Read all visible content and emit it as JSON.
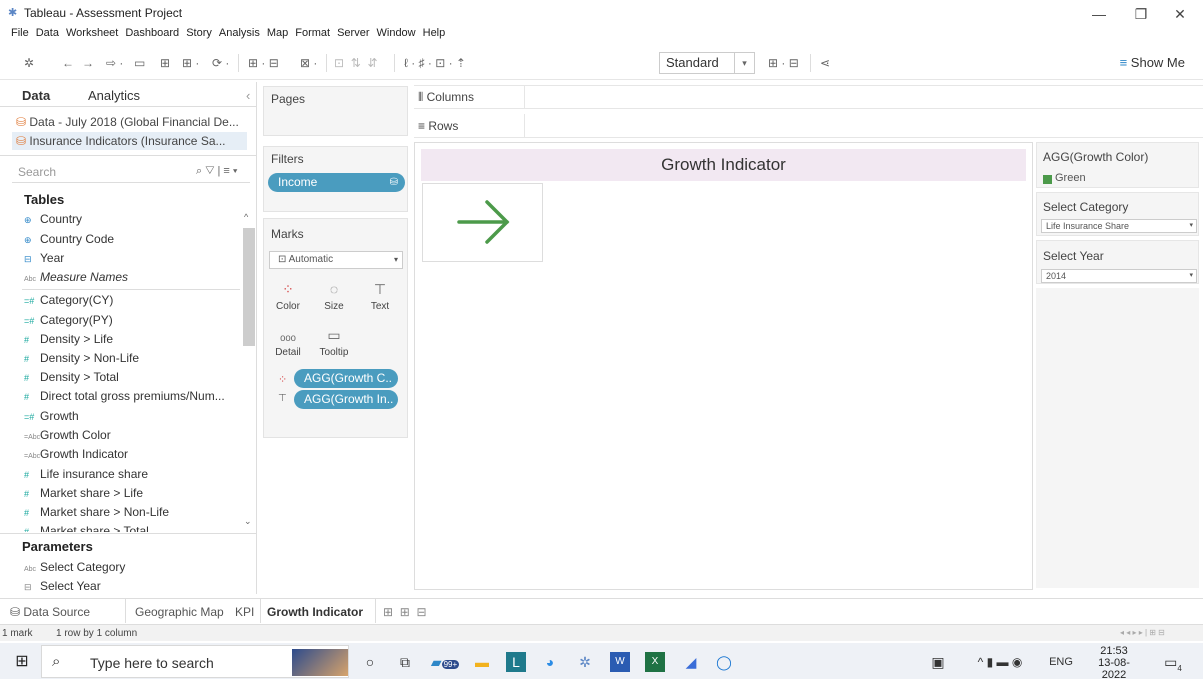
{
  "window": {
    "title": "Tableau - Assessment Project",
    "logo_icon": "tableau-logo-icon"
  },
  "menu": [
    "File",
    "Data",
    "Worksheet",
    "Dashboard",
    "Story",
    "Analysis",
    "Map",
    "Format",
    "Server",
    "Window",
    "Help"
  ],
  "toolbar": {
    "fit_select": "Standard",
    "show_me": "Show Me"
  },
  "data_pane": {
    "tabs": [
      "Data",
      "Analytics"
    ],
    "sources": [
      "Data - July 2018 (Global Financial De...",
      "Insurance Indicators (Insurance Sa..."
    ],
    "search_placeholder": "Search",
    "tables_heading": "Tables",
    "fields": [
      "Country",
      "Country Code",
      "Year",
      "Measure Names",
      "Category(CY)",
      "Category(PY)",
      "Density > Life",
      "Density > Non-Life",
      "Density > Total",
      "Direct total gross premiums/Num...",
      "Growth",
      "Growth Color",
      "Growth Indicator",
      "Life insurance share",
      "Market share > Life",
      "Market share > Non-Life",
      "Market share > Total"
    ],
    "parameters_heading": "Parameters",
    "parameters": [
      "Select Category",
      "Select Year"
    ]
  },
  "shelves": {
    "pages": "Pages",
    "filters": "Filters",
    "filter_pill": "Income",
    "marks": "Marks",
    "mark_type": "Automatic",
    "mark_buttons": [
      "Color",
      "Size",
      "Text",
      "Detail",
      "Tooltip"
    ],
    "mark_pills": [
      "AGG(Growth C..",
      "AGG(Growth In.."
    ],
    "columns": "Columns",
    "rows": "Rows"
  },
  "view": {
    "title": "Growth Indicator",
    "arrow_color": "#4c9a4a"
  },
  "right_pane": {
    "legend_title": "AGG(Growth Color)",
    "legend_item": "Green",
    "legend_color": "#4c9a4a",
    "param1_title": "Select Category",
    "param1_value": "Life Insurance Share",
    "param2_title": "Select Year",
    "param2_value": "2014"
  },
  "tabs": {
    "data_source": "Data Source",
    "sheets": [
      "Geographic Map",
      "KPI",
      "Growth Indicator"
    ]
  },
  "status": {
    "marks": "1 mark",
    "dims": "1 row by 1 column"
  },
  "taskbar": {
    "search_placeholder": "Type here to search",
    "badge": "99+",
    "lang": "ENG",
    "time": "21:53",
    "date": "13-08-2022",
    "notif": "4"
  }
}
